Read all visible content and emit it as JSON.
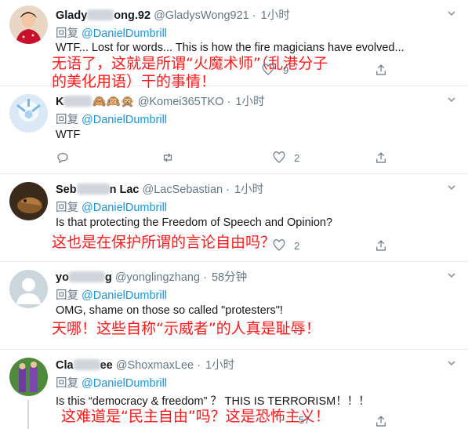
{
  "tweets": [
    {
      "name_start": "Glady",
      "name_end": "ong.92",
      "handle": "@GladysWong921",
      "time": "1小时",
      "reply_label": "回复",
      "reply_to": "@DanielDumbrill",
      "text": "WTF... Lost for words... This is how the fire magicians have evolved...",
      "annotation": [
        "无语了，这就是所谓“火魔术师”（乱港分子",
        "的美化用语）干的事情！"
      ],
      "reply_count": "",
      "like_count": "9"
    },
    {
      "name_start": "K",
      "name_end": "🙈🙉🙊",
      "handle": "@Komei365TKO",
      "time": "1小时",
      "reply_label": "回复",
      "reply_to": "@DanielDumbrill",
      "text": "WTF",
      "annotation": [],
      "reply_count": "",
      "like_count": "2"
    },
    {
      "name_start": "Seb",
      "name_end": "n Lac",
      "handle": "@LacSebastian",
      "time": "1小时",
      "reply_label": "回复",
      "reply_to": "@DanielDumbrill",
      "text": "Is that protecting the Freedom of Speech and Opinion?",
      "annotation": [
        "这也是在保护所谓的言论自由吗？"
      ],
      "reply_count": "",
      "like_count": "2"
    },
    {
      "name_start": "yo",
      "name_end": "g",
      "handle": "@yonglingzhang",
      "time": "58分钟",
      "reply_label": "回复",
      "reply_to": "@DanielDumbrill",
      "text": "OMG, shame on those so called \"protesters\"!",
      "annotation": [
        "天哪！这些自称“示威者”的人真是耻辱！"
      ],
      "reply_count": "",
      "like_count": ""
    },
    {
      "name_start": "Cla",
      "name_end": "ee",
      "handle": "@ShoxmaxLee",
      "time": "1小时",
      "reply_label": "回复",
      "reply_to": "@DanielDumbrill",
      "text": "Is this “democracy & freedom” ？ THIS IS TERRORISM！！！",
      "annotation": [
        "这难道是“民主自由”吗？这是恐怖主义！"
      ],
      "reply_count": "",
      "like_count": "57"
    }
  ],
  "colors": {
    "link": "#1b95e0",
    "muted": "#657786",
    "annotation": "#ff1a1a"
  }
}
